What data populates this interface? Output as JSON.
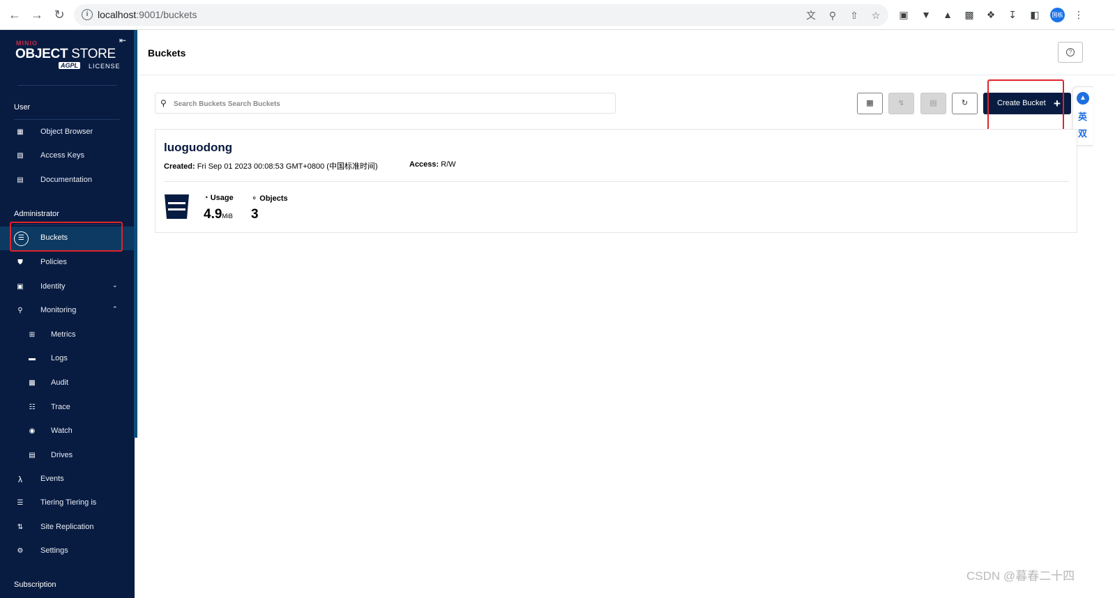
{
  "browser": {
    "url_host": "localhost",
    "url_path": ":9001/buckets",
    "profile_label": "国栋"
  },
  "sidebar": {
    "logo_brand": "MINIO",
    "logo_title_bold": "OBJECT",
    "logo_title_thin": "STORE",
    "logo_agpl": "AGPL",
    "logo_license": "LICENSE",
    "sections": {
      "user": "User",
      "administrator": "Administrator",
      "subscription": "Subscription"
    },
    "user_items": [
      {
        "label": "Object Browser",
        "icon": "object-browser-icon"
      },
      {
        "label": "Access Keys",
        "icon": "access-keys-icon"
      },
      {
        "label": "Documentation",
        "icon": "documentation-icon"
      }
    ],
    "admin_items": [
      {
        "label": "Buckets",
        "icon": "bucket-icon",
        "active": true
      },
      {
        "label": "Policies",
        "icon": "shield-icon"
      },
      {
        "label": "Identity",
        "icon": "identity-icon",
        "expandable": true
      },
      {
        "label": "Monitoring",
        "icon": "monitoring-icon",
        "expanded": true
      },
      {
        "label": "Metrics",
        "icon": "metrics-icon",
        "sub": true
      },
      {
        "label": "Logs",
        "icon": "logs-icon",
        "sub": true
      },
      {
        "label": "Audit",
        "icon": "audit-icon",
        "sub": true
      },
      {
        "label": "Trace",
        "icon": "trace-icon",
        "sub": true
      },
      {
        "label": "Watch",
        "icon": "watch-icon",
        "sub": true
      },
      {
        "label": "Drives",
        "icon": "drives-icon",
        "sub": true
      },
      {
        "label": "Events",
        "icon": "lambda-icon"
      },
      {
        "label": "Tiering Tiering is",
        "icon": "tiering-icon"
      },
      {
        "label": "Site Replication",
        "icon": "replication-icon"
      },
      {
        "label": "Settings",
        "icon": "gear-icon"
      }
    ]
  },
  "header": {
    "title": "Buckets",
    "help_icon": "?"
  },
  "toolbar": {
    "search_placeholder": "Search Buckets Search Buckets",
    "create_label": "Create Bucket"
  },
  "side_float": {
    "line1": "英",
    "line2": "双"
  },
  "bucket": {
    "name": "luoguodong",
    "created_label": "Created:",
    "created_value": "Fri Sep 01 2023 00:08:53 GMT+0800 (中国标准时间)",
    "access_label": "Access:",
    "access_value": "R/W",
    "usage_label": "Usage",
    "usage_value": "4.9",
    "usage_unit": "MiB",
    "objects_label": "Objects",
    "objects_value": "3"
  },
  "watermark": "CSDN @暮春二十四",
  "colors": {
    "sidebar_bg": "#081c42",
    "accent": "#081c42",
    "highlight_box": "#e0242a"
  }
}
